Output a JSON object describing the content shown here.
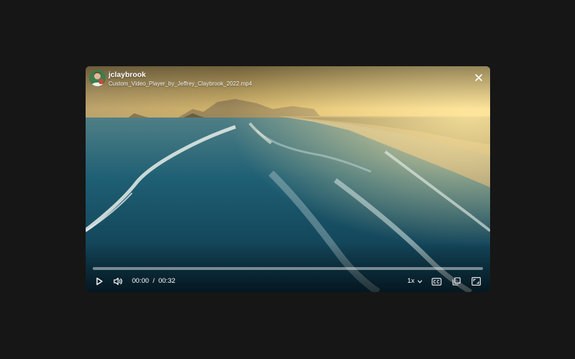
{
  "header": {
    "username": "jclaybrook",
    "filename": "Custom_Video_Player_by_Jeffrey_Claybrook_2022.mp4"
  },
  "player": {
    "progress_fraction": 0.0,
    "time_current": "00:00",
    "time_separator": "/",
    "time_total": "00:32",
    "speed_label": "1x"
  },
  "icons": {
    "close": "close-icon",
    "play": "play-icon",
    "volume": "volume-icon",
    "speed_dropdown": "chevron-down-icon",
    "captions": "closed-captions-icon",
    "pip": "picture-in-picture-icon",
    "fullscreen": "fullscreen-icon"
  },
  "colors": {
    "page_background": "#161616",
    "control_foreground": "#ffffff"
  }
}
